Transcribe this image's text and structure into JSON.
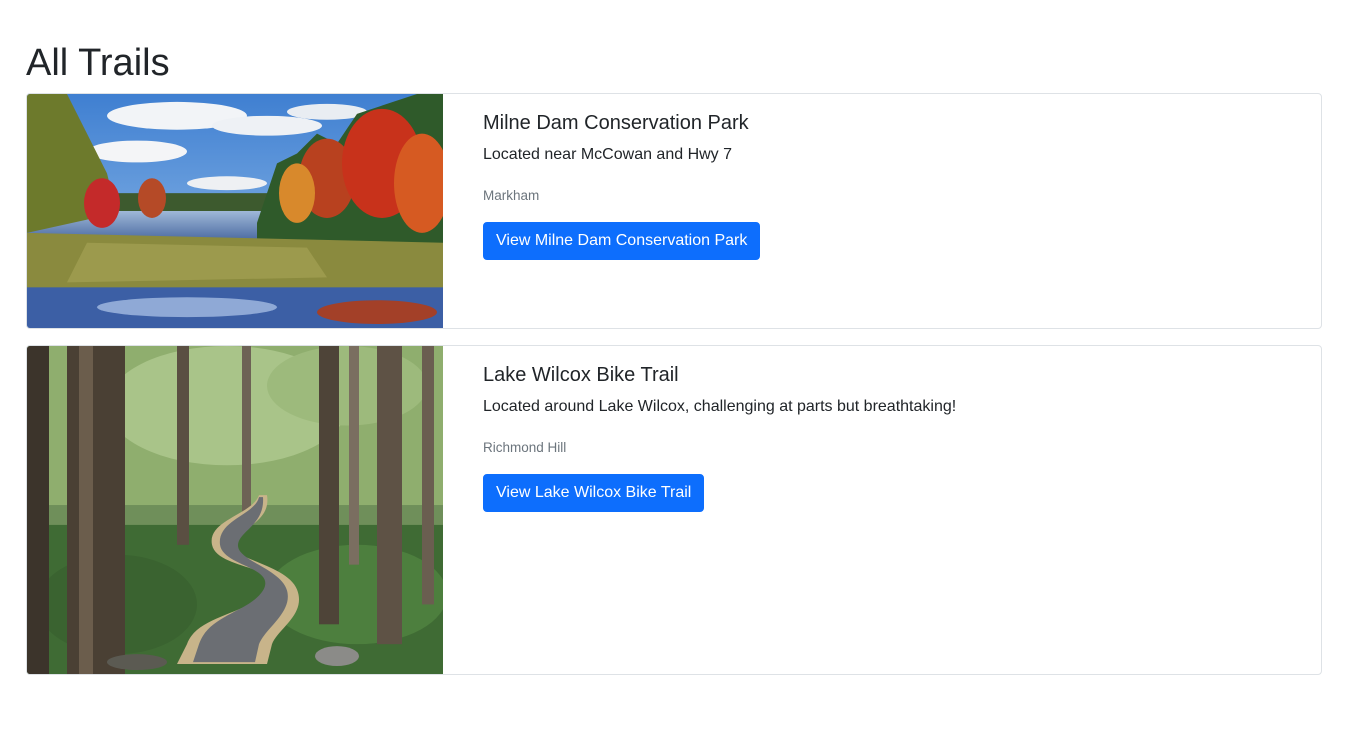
{
  "page": {
    "title": "All Trails"
  },
  "trails": [
    {
      "title": "Milne Dam Conservation Park",
      "description": "Located near McCowan and Hwy 7",
      "location": "Markham",
      "button_label": "View Milne Dam Conservation Park",
      "image": "autumn-lake-photo"
    },
    {
      "title": "Lake Wilcox Bike Trail",
      "description": "Located around Lake Wilcox, challenging at parts but breathtaking!",
      "location": "Richmond Hill",
      "button_label": "View Lake Wilcox Bike Trail",
      "image": "forest-boardwalk-trail-photo"
    }
  ],
  "colors": {
    "primary": "#0d6efd",
    "muted_text": "#6c757d",
    "border": "#dee2e6"
  }
}
